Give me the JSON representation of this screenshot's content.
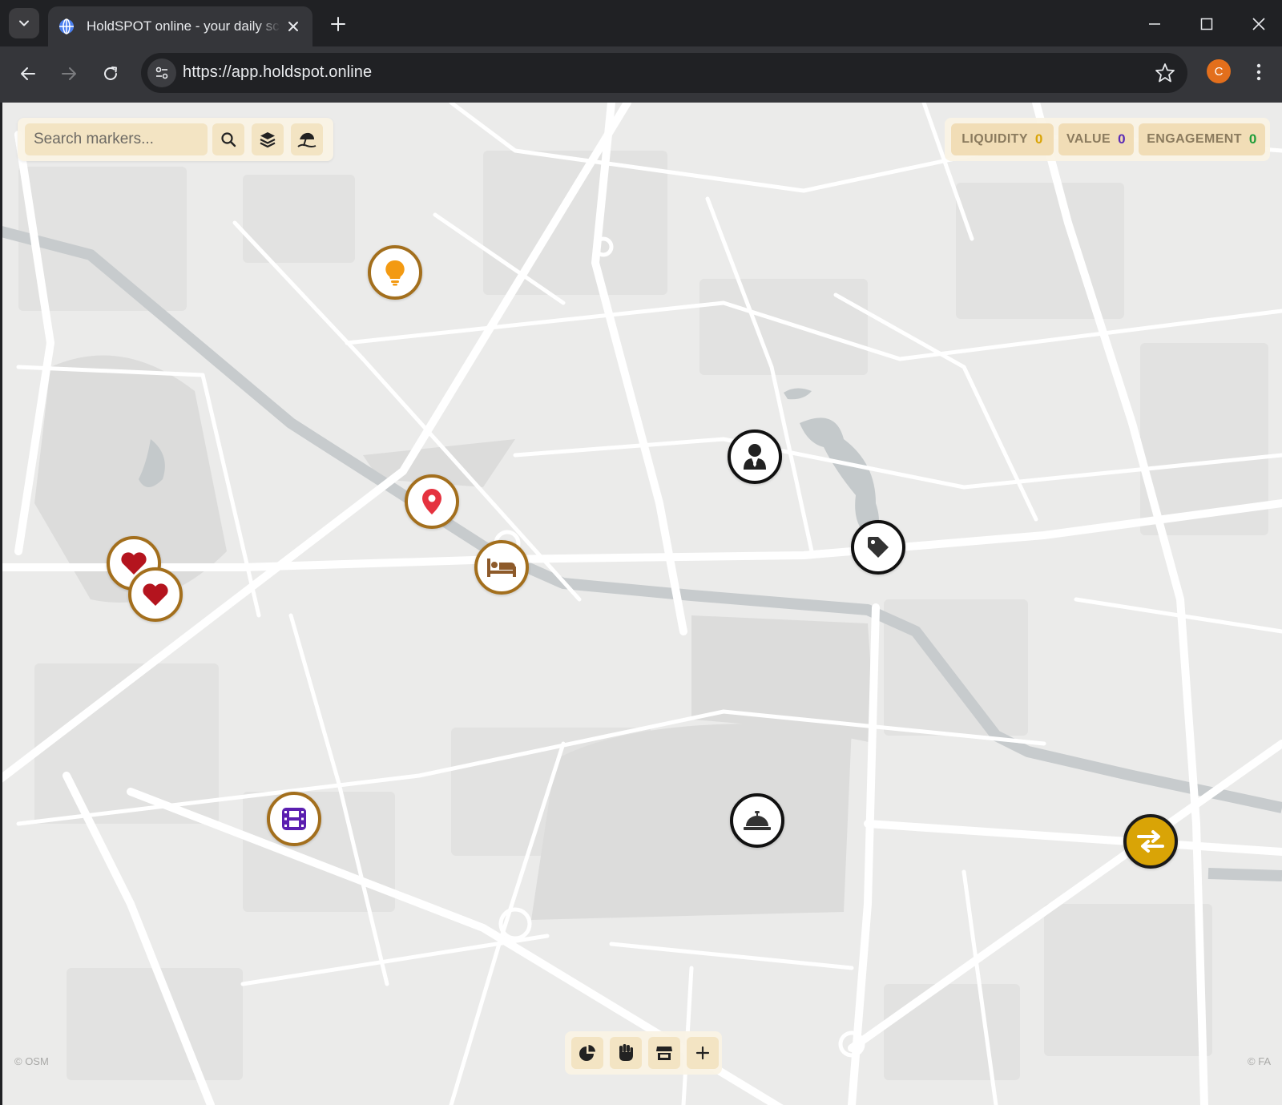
{
  "browser": {
    "tab_title": "HoldSPOT online - your daily sc",
    "url": "https://app.holdspot.online",
    "profile_initial": "C"
  },
  "map": {
    "search": {
      "placeholder": "Search markers..."
    },
    "buttons": [
      "search-icon",
      "layers-icon",
      "umbrella-beach-icon"
    ],
    "stats": [
      {
        "label": "LIQUIDITY",
        "value": "0",
        "value_color": "#d9a406"
      },
      {
        "label": "VALUE",
        "value": "0",
        "value_color": "#5b2bb5"
      },
      {
        "label": "ENGAGEMENT",
        "value": "0",
        "value_color": "#1f9d3a"
      }
    ],
    "markers": [
      {
        "name": "lightbulb",
        "style": "brown",
        "color": "#f39a12"
      },
      {
        "name": "location-pin",
        "style": "brown",
        "color": "#e5323f"
      },
      {
        "name": "bed",
        "style": "brown",
        "color": "#8d5a2a"
      },
      {
        "name": "heart",
        "style": "brown",
        "color": "#b4141e"
      },
      {
        "name": "heart",
        "style": "brown",
        "color": "#b4141e"
      },
      {
        "name": "film",
        "style": "brown",
        "color": "#5b1fb0"
      },
      {
        "name": "user-tie",
        "style": "black",
        "color": "#222222"
      },
      {
        "name": "tag",
        "style": "black",
        "color": "#333333"
      },
      {
        "name": "concierge-bell",
        "style": "black",
        "color": "#333333"
      },
      {
        "name": "exchange",
        "style": "gold",
        "color": "#ffffff"
      }
    ],
    "bottom_buttons": [
      "chart-pie-icon",
      "hand-fist-icon",
      "store-icon",
      "plus-icon"
    ],
    "attribution_left": "© OSM",
    "attribution_right": "© FA"
  }
}
